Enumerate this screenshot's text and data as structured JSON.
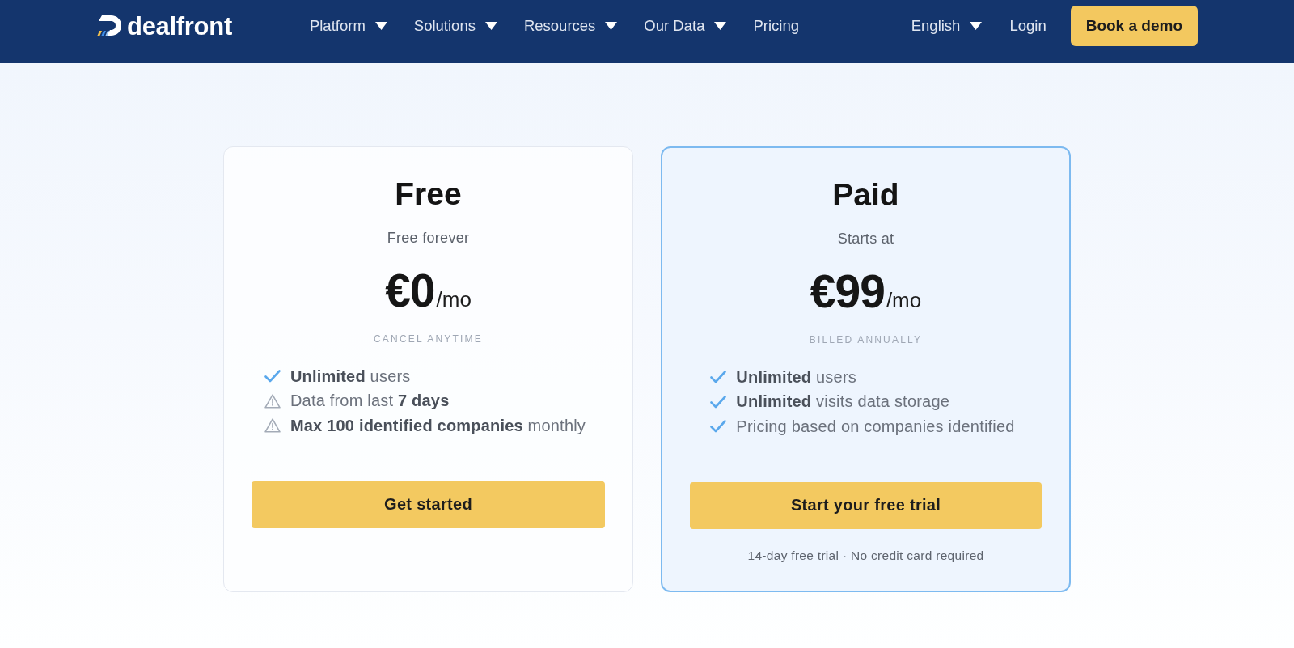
{
  "header": {
    "logo": {
      "text": "dealfront"
    },
    "nav": [
      {
        "label": "Platform",
        "dropdown": true
      },
      {
        "label": "Solutions",
        "dropdown": true
      },
      {
        "label": "Resources",
        "dropdown": true
      },
      {
        "label": "Our Data",
        "dropdown": true
      },
      {
        "label": "Pricing",
        "dropdown": false
      }
    ],
    "language": {
      "label": "English",
      "dropdown": true
    },
    "login": "Login",
    "cta": "Book a demo"
  },
  "plans": [
    {
      "name": "Free",
      "subtitle": "Free forever",
      "price": "€0",
      "period": "/mo",
      "note": "CANCEL ANYTIME",
      "highlighted": false,
      "features": [
        {
          "kind": "check",
          "text": "**Unlimited** users"
        },
        {
          "kind": "warning",
          "text": "Data from last **7 days**"
        },
        {
          "kind": "warning",
          "text": "**Max 100 identified companies** monthly"
        }
      ],
      "button": "Get started"
    },
    {
      "name": "Paid",
      "subtitle": "Starts at",
      "price": "€99",
      "period": "/mo",
      "note": "BILLED ANNUALLY",
      "highlighted": true,
      "features": [
        {
          "kind": "check",
          "text": "**Unlimited** users"
        },
        {
          "kind": "check",
          "text": "**Unlimited** visits data storage"
        },
        {
          "kind": "check",
          "text": "Pricing based on companies identified"
        }
      ],
      "button": "Start your free trial",
      "footnote": "14-day free trial · No credit card required"
    }
  ]
}
